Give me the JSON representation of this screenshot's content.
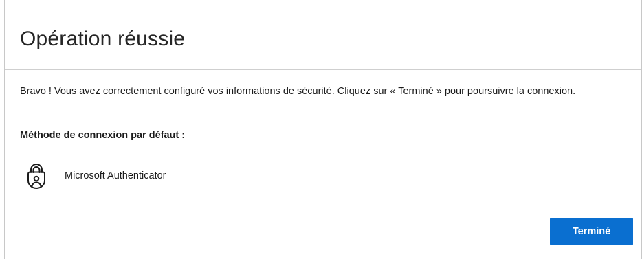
{
  "dialog": {
    "title": "Opération réussie",
    "message": "Bravo ! Vous avez correctement configuré vos informations de sécurité. Cliquez sur « Terminé » pour poursuivre la connexion.",
    "default_method_heading": "Méthode de connexion par défaut :",
    "method": {
      "icon": "authenticator-lock-icon",
      "label": "Microsoft Authenticator"
    },
    "done_button_label": "Terminé"
  },
  "colors": {
    "accent": "#0a6fd0",
    "text": "#1b1b1b",
    "divider": "#cfcfcf"
  }
}
